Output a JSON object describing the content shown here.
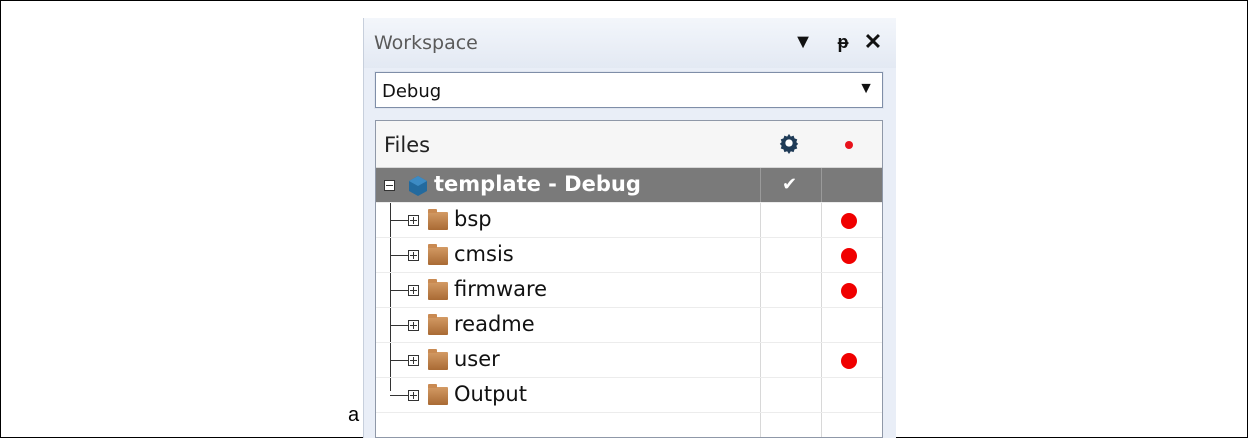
{
  "caption": "a",
  "workspace": {
    "title": "Workspace",
    "buttons": {
      "menu": "▼",
      "pin": "ᵽ",
      "close": "✕"
    },
    "configuration": {
      "selected": "Debug"
    },
    "files": {
      "header": "Files",
      "header_icons": [
        "gear-icon",
        "red-dot-icon"
      ],
      "project": {
        "label": "template - Debug",
        "checked": true,
        "check_mark": "✔"
      },
      "items": [
        {
          "label": "bsp",
          "has_dot": true
        },
        {
          "label": "cmsis",
          "has_dot": true
        },
        {
          "label": "firmware",
          "has_dot": true
        },
        {
          "label": "readme",
          "has_dot": false
        },
        {
          "label": "user",
          "has_dot": true
        },
        {
          "label": "Output",
          "has_dot": false
        }
      ]
    }
  },
  "colors": {
    "selected_row": "#7a7a7a",
    "dot": "#f00000",
    "folder": "#b97a42",
    "project_icon": "#236a9e"
  }
}
